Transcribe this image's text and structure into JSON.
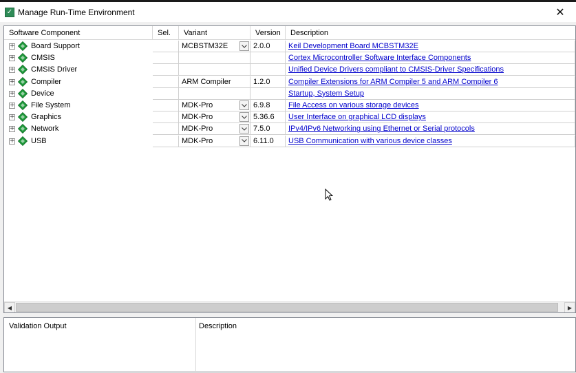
{
  "window": {
    "title": "Manage Run-Time Environment",
    "icon": "app-icon",
    "close_label": "✕",
    "watermark": "│–╫≤│"
  },
  "table": {
    "headers": {
      "component": "Software Component",
      "sel": "Sel.",
      "variant": "Variant",
      "version": "Version",
      "description": "Description"
    },
    "colors": {
      "component_icon": "#1e9a3a",
      "link": "#0000cc"
    },
    "rows": [
      {
        "component": "Board Support",
        "sel": "",
        "variant": "MCBSTM32E",
        "has_dropdown": true,
        "version": "2.0.0",
        "description": "Keil Development Board MCBSTM32E"
      },
      {
        "component": "CMSIS",
        "sel": "",
        "variant": "",
        "has_dropdown": false,
        "version": "",
        "description": "Cortex Microcontroller Software Interface Components"
      },
      {
        "component": "CMSIS Driver",
        "sel": "",
        "variant": "",
        "has_dropdown": false,
        "version": "",
        "description": "Unified Device Drivers compliant to CMSIS-Driver Specifications"
      },
      {
        "component": "Compiler",
        "sel": "",
        "variant": "ARM Compiler",
        "has_dropdown": false,
        "version": "1.2.0",
        "description": "Compiler Extensions for ARM Compiler 5 and ARM Compiler 6"
      },
      {
        "component": "Device",
        "sel": "",
        "variant": "",
        "has_dropdown": false,
        "version": "",
        "description": "Startup, System Setup"
      },
      {
        "component": "File System",
        "sel": "",
        "variant": "MDK-Pro",
        "has_dropdown": true,
        "version": "6.9.8",
        "description": "File Access on various storage devices"
      },
      {
        "component": "Graphics",
        "sel": "",
        "variant": "MDK-Pro",
        "has_dropdown": true,
        "version": "5.36.6",
        "description": "User Interface on graphical LCD displays"
      },
      {
        "component": "Network",
        "sel": "",
        "variant": "MDK-Pro",
        "has_dropdown": true,
        "version": "7.5.0",
        "description": "IPv4/IPv6 Networking using Ethernet or Serial protocols"
      },
      {
        "component": "USB",
        "sel": "",
        "variant": "MDK-Pro",
        "has_dropdown": true,
        "version": "6.11.0",
        "description": "USB Communication with various device classes"
      }
    ]
  },
  "scrollbar": {
    "left_arrow": "◀",
    "right_arrow": "▶"
  },
  "validation": {
    "output_header": "Validation Output",
    "description_header": "Description"
  }
}
